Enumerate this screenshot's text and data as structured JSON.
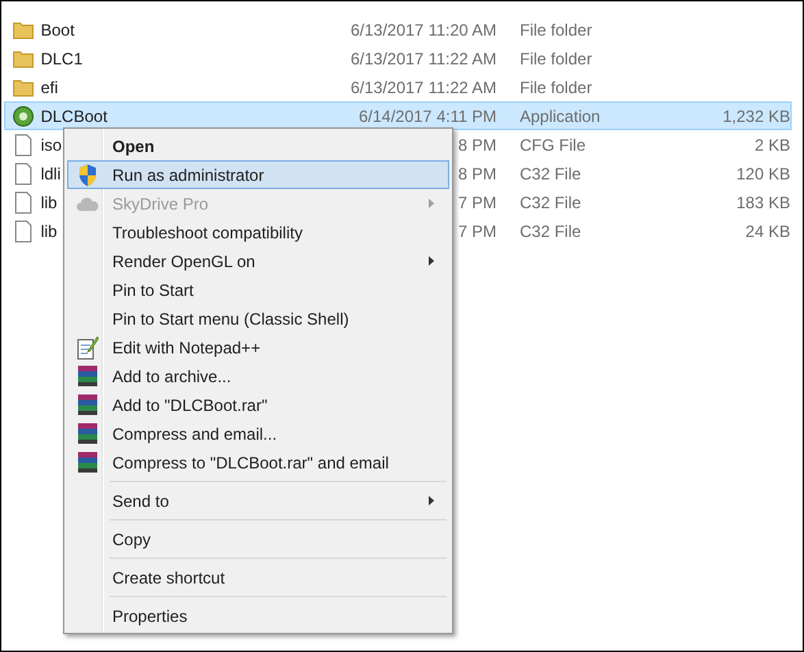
{
  "files": [
    {
      "kind": "folder",
      "name": "Boot",
      "date": "6/13/2017 11:20 AM",
      "type": "File folder",
      "selected": false
    },
    {
      "kind": "folder",
      "name": "DLC1",
      "date": "6/13/2017 11:22 AM",
      "type": "File folder",
      "selected": false
    },
    {
      "kind": "folder",
      "name": "efi",
      "date": "6/13/2017 11:22 AM",
      "type": "File folder",
      "selected": false
    },
    {
      "kind": "application",
      "name": "DLCBoot",
      "date": "6/14/2017 4:11 PM",
      "type": "Application",
      "size": "1,232 KB",
      "selected": true
    },
    {
      "kind": "document",
      "name": "iso",
      "date": "8 PM",
      "type": "CFG File",
      "size": "2 KB",
      "selected": false
    },
    {
      "kind": "document",
      "name": "ldli",
      "date": "8 PM",
      "type": "C32 File",
      "size": "120 KB",
      "selected": false
    },
    {
      "kind": "document",
      "name": "lib",
      "date": "7 PM",
      "type": "C32 File",
      "size": "183 KB",
      "selected": false
    },
    {
      "kind": "document",
      "name": "lib",
      "date": "7 PM",
      "type": "C32 File",
      "size": "24 KB",
      "selected": false
    }
  ],
  "context_menu": {
    "items": [
      {
        "kind": "plain",
        "label": "Open",
        "bold": true,
        "selected": false,
        "disabled": false,
        "submenu": false
      },
      {
        "kind": "shield",
        "label": "Run as administrator",
        "bold": false,
        "selected": true,
        "disabled": false,
        "submenu": false
      },
      {
        "kind": "cloud",
        "label": "SkyDrive Pro",
        "bold": false,
        "selected": false,
        "disabled": true,
        "submenu": true
      },
      {
        "kind": "plain",
        "label": "Troubleshoot compatibility",
        "bold": false,
        "selected": false,
        "disabled": false,
        "submenu": false
      },
      {
        "kind": "plain",
        "label": "Render OpenGL on",
        "bold": false,
        "selected": false,
        "disabled": false,
        "submenu": true
      },
      {
        "kind": "plain",
        "label": "Pin to Start",
        "bold": false,
        "selected": false,
        "disabled": false,
        "submenu": false
      },
      {
        "kind": "plain",
        "label": "Pin to Start menu (Classic Shell)",
        "bold": false,
        "selected": false,
        "disabled": false,
        "submenu": false
      },
      {
        "kind": "notepad",
        "label": "Edit with Notepad++",
        "bold": false,
        "selected": false,
        "disabled": false,
        "submenu": false
      },
      {
        "kind": "archive",
        "label": "Add to archive...",
        "bold": false,
        "selected": false,
        "disabled": false,
        "submenu": false
      },
      {
        "kind": "archive",
        "label": "Add to \"DLCBoot.rar\"",
        "bold": false,
        "selected": false,
        "disabled": false,
        "submenu": false
      },
      {
        "kind": "archive",
        "label": "Compress and email...",
        "bold": false,
        "selected": false,
        "disabled": false,
        "submenu": false
      },
      {
        "kind": "archive",
        "label": "Compress to \"DLCBoot.rar\" and email",
        "bold": false,
        "selected": false,
        "disabled": false,
        "submenu": false
      },
      {
        "kind": "separator"
      },
      {
        "kind": "plain",
        "label": "Send to",
        "bold": false,
        "selected": false,
        "disabled": false,
        "submenu": true
      },
      {
        "kind": "separator"
      },
      {
        "kind": "plain",
        "label": "Copy",
        "bold": false,
        "selected": false,
        "disabled": false,
        "submenu": false
      },
      {
        "kind": "separator"
      },
      {
        "kind": "plain",
        "label": "Create shortcut",
        "bold": false,
        "selected": false,
        "disabled": false,
        "submenu": false
      },
      {
        "kind": "separator"
      },
      {
        "kind": "plain",
        "label": "Properties",
        "bold": false,
        "selected": false,
        "disabled": false,
        "submenu": false
      }
    ]
  }
}
